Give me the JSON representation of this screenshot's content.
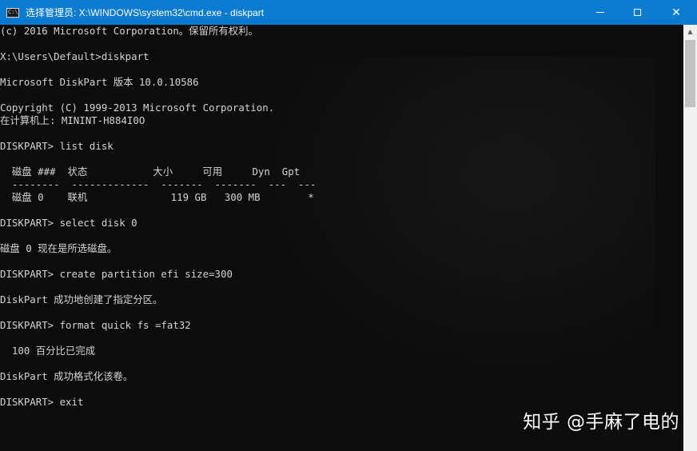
{
  "window": {
    "title": "选择管理员: X:\\WINDOWS\\system32\\cmd.exe - diskpart",
    "icon": "cmd-icon",
    "icon_text": "C:\\",
    "controls": {
      "minimize": "minimize-icon",
      "maximize": "maximize-icon",
      "close_glyph": "✕"
    },
    "title_bar_color": "#0b7ad1"
  },
  "console": {
    "text_color": "#d4d4d4",
    "background": "#0c0c0c",
    "lines": [
      "(c) 2016 Microsoft Corporation。保留所有权利。",
      "",
      "X:\\Users\\Default>diskpart",
      "",
      "Microsoft DiskPart 版本 10.0.10586",
      "",
      "Copyright (C) 1999-2013 Microsoft Corporation.",
      "在计算机上: MININT-H884I0O",
      "",
      "DISKPART> list disk",
      "",
      "  磁盘 ###  状态           大小     可用     Dyn  Gpt",
      "  --------  -------------  -------  -------  ---  ---",
      "  磁盘 0    联机              119 GB   300 MB        *",
      "",
      "DISKPART> select disk 0",
      "",
      "磁盘 0 现在是所选磁盘。",
      "",
      "DISKPART> create partition efi size=300",
      "",
      "DiskPart 成功地创建了指定分区。",
      "",
      "DISKPART> format quick fs =fat32",
      "",
      "  100 百分比已完成",
      "",
      "DiskPart 成功格式化该卷。",
      "",
      "DISKPART> exit"
    ]
  },
  "scrollbar": {
    "up_arrow": "▲"
  },
  "watermark": "知乎 @手麻了电的"
}
